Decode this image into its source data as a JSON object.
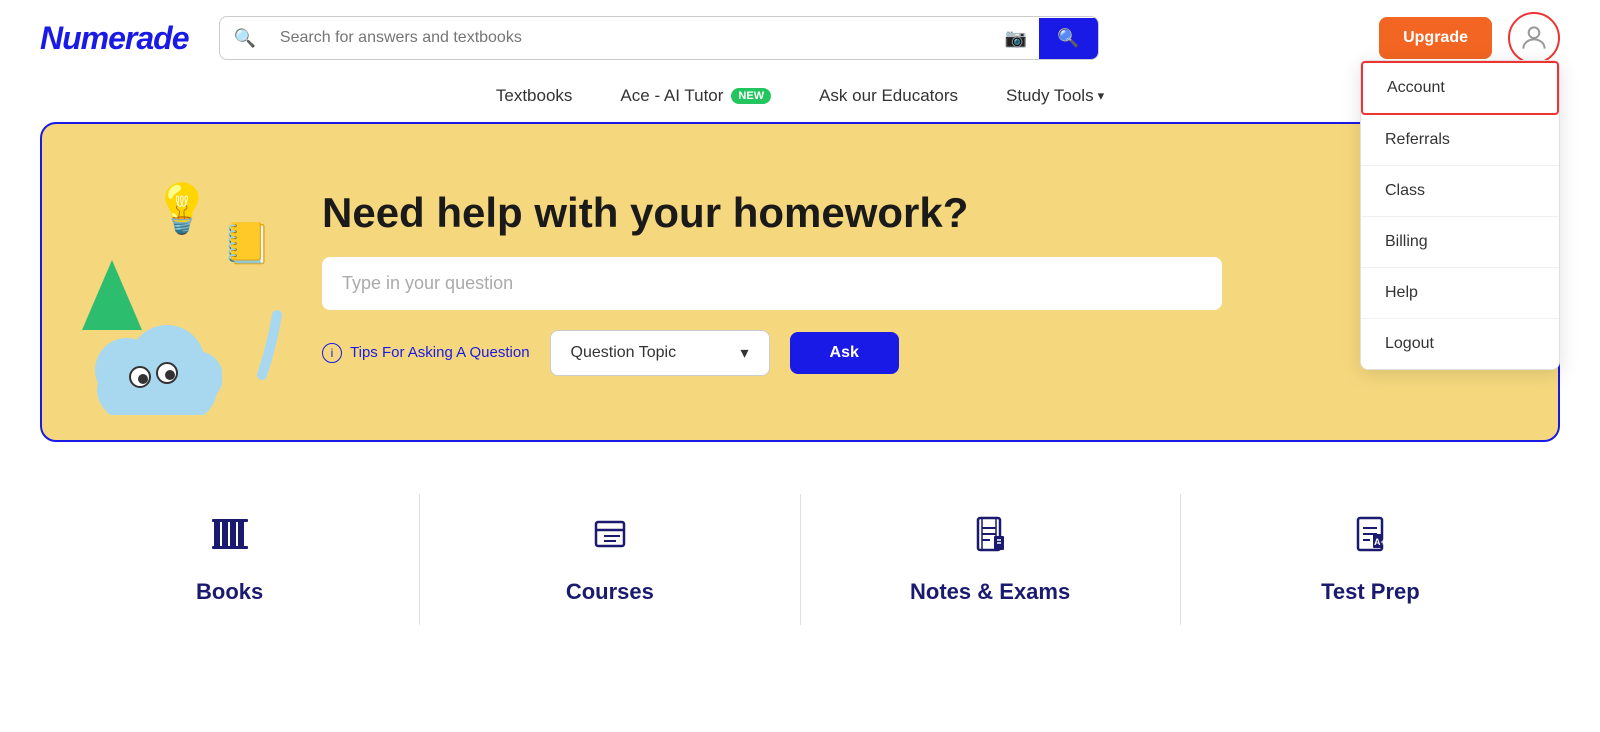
{
  "header": {
    "logo": "Numerade",
    "search": {
      "placeholder": "Search for answers and textbooks"
    },
    "upgrade_label": "Upgrade"
  },
  "nav": {
    "items": [
      {
        "id": "textbooks",
        "label": "Textbooks"
      },
      {
        "id": "ace-ai",
        "label": "Ace - AI Tutor",
        "badge": "NEW"
      },
      {
        "id": "ask-educators",
        "label": "Ask our Educators"
      },
      {
        "id": "study-tools",
        "label": "Study Tools"
      }
    ]
  },
  "dropdown": {
    "items": [
      {
        "id": "account",
        "label": "Account",
        "active": true
      },
      {
        "id": "referrals",
        "label": "Referrals"
      },
      {
        "id": "class",
        "label": "Class"
      },
      {
        "id": "billing",
        "label": "Billing"
      },
      {
        "id": "help",
        "label": "Help"
      },
      {
        "id": "logout",
        "label": "Logout"
      }
    ]
  },
  "hero": {
    "title": "Need help with your homework?",
    "input_placeholder": "Type in your question",
    "tips_label": "Tips For Asking A Question",
    "topic_placeholder": "Question Topic",
    "ask_label": "Ask"
  },
  "bottom": {
    "items": [
      {
        "id": "books",
        "label": "Books",
        "icon": "📚"
      },
      {
        "id": "courses",
        "label": "Courses",
        "icon": "📋"
      },
      {
        "id": "notes-exams",
        "label": "Notes & Exams",
        "icon": "📝"
      },
      {
        "id": "test-prep",
        "label": "Test Prep",
        "icon": "📄"
      }
    ]
  }
}
